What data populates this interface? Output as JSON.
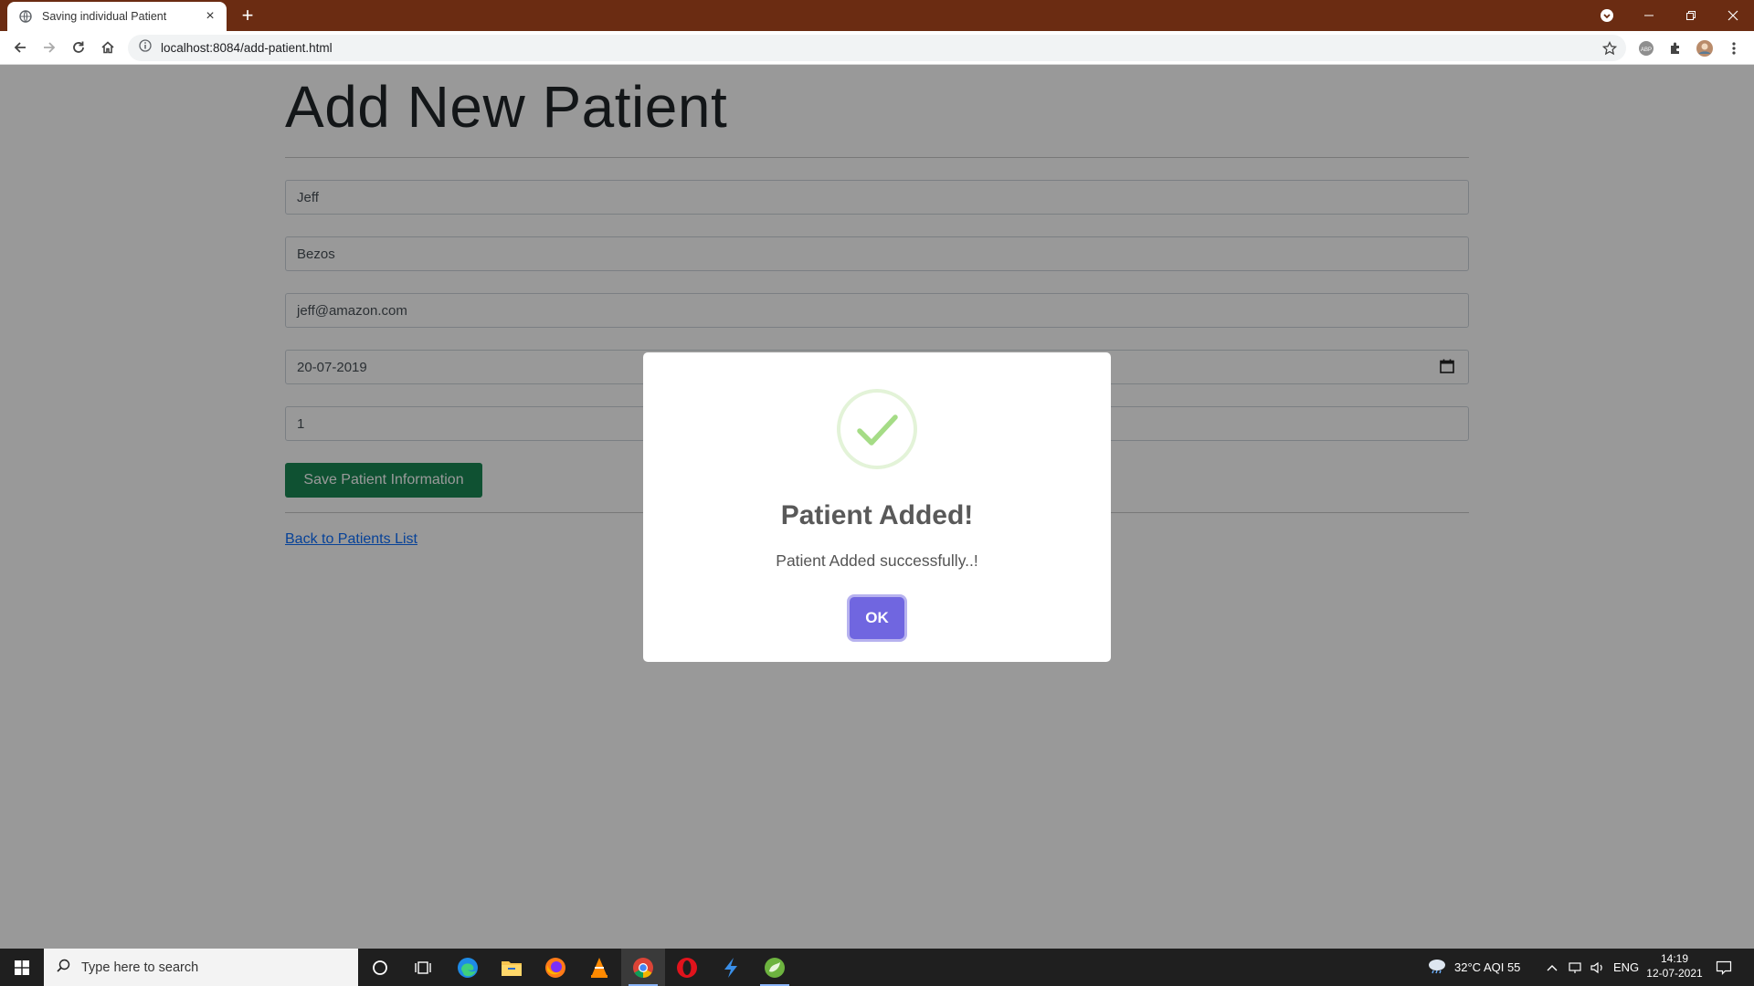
{
  "browser": {
    "tab_title": "Saving individual Patient",
    "url": "localhost:8084/add-patient.html",
    "new_tab": "+",
    "tab_close": "×"
  },
  "page": {
    "title": "Add New Patient",
    "fields": {
      "first_name": "Jeff",
      "last_name": "Bezos",
      "email": "jeff@amazon.com",
      "date": "20-07-2019",
      "number": "1"
    },
    "save_button": "Save Patient Information",
    "back_link": "Back to Patients List"
  },
  "modal": {
    "title": "Patient Added!",
    "text": "Patient Added successfully..!",
    "ok_button": "OK"
  },
  "taskbar": {
    "search_placeholder": "Type here to search",
    "weather": "32°C AQI 55",
    "language": "ENG",
    "time": "14:19",
    "date": "12-07-2021"
  },
  "colors": {
    "titlebar": "#6b2c12",
    "save_button": "#198754",
    "ok_button": "#7066e0",
    "check": "#a5dc86",
    "link": "#0d6efd"
  },
  "icons": [
    "globe-icon",
    "back-icon",
    "forward-icon",
    "reload-icon",
    "home-icon",
    "info-icon",
    "star-icon",
    "abp-icon",
    "extensions-icon",
    "profile-icon",
    "menu-icon",
    "calendar-icon",
    "check-icon",
    "windows-icon",
    "search-icon",
    "cortana-icon",
    "task-view-icon",
    "edge-icon",
    "file-explorer-icon",
    "firefox-icon",
    "vlc-icon",
    "chrome-icon",
    "opera-icon",
    "flash-icon",
    "spring-icon",
    "weather-icon",
    "chevron-up-icon",
    "network-icon",
    "volume-icon",
    "notification-icon"
  ]
}
